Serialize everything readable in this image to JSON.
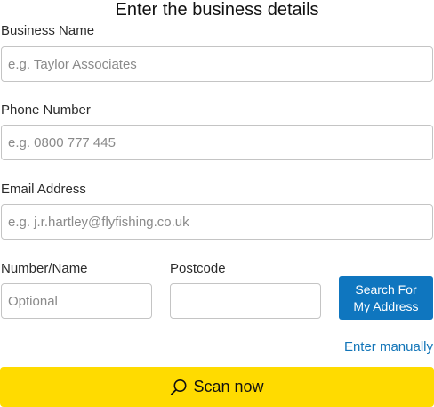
{
  "form": {
    "title": "Enter the business details",
    "business_name": {
      "label": "Business Name",
      "placeholder": "e.g. Taylor Associates",
      "value": ""
    },
    "phone_number": {
      "label": "Phone Number",
      "placeholder": "e.g. 0800 777 445",
      "value": ""
    },
    "email_address": {
      "label": "Email Address",
      "placeholder": "e.g. j.r.hartley@flyfishing.co.uk",
      "value": ""
    },
    "number_name": {
      "label": "Number/Name",
      "placeholder": "Optional",
      "value": ""
    },
    "postcode": {
      "label": "Postcode",
      "placeholder": "",
      "value": ""
    },
    "search_button": {
      "line1": "Search For",
      "line2": "My Address"
    },
    "enter_manually": "Enter manually",
    "scan_button": {
      "label": "Scan now",
      "icon": "search-icon"
    }
  },
  "colors": {
    "primary_blue": "#0f76bf",
    "link_blue": "#1275b8",
    "scan_yellow": "#ffdb00",
    "field_border": "#c4c4c4"
  }
}
